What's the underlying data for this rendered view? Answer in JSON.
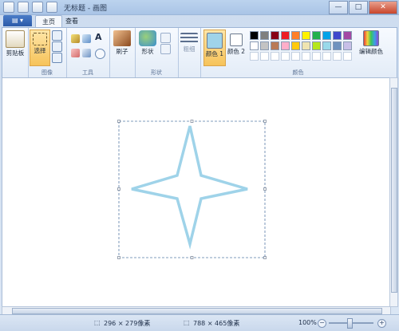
{
  "window": {
    "title": "无标题 - 画图"
  },
  "tabs": {
    "file": "▤ ▾",
    "home": "主页",
    "view": "查看"
  },
  "ribbon": {
    "clipboard": {
      "label": "剪贴板"
    },
    "image": {
      "select_label": "选择",
      "group": "图像"
    },
    "tools": {
      "group": "工具",
      "text_tool": "A"
    },
    "brushes": {
      "label": "刷子"
    },
    "shapes": {
      "label": "形状",
      "group": "形状"
    },
    "size": {
      "label": "粗细"
    },
    "colors": {
      "color1_label": "颜色 1",
      "color2_label": "颜色 2",
      "edit_label": "编辑颜色",
      "group": "颜色",
      "color1": "#9fd3e9",
      "color2": "#ffffff",
      "palette_row1": [
        "#000000",
        "#7f7f7f",
        "#880015",
        "#ed1c24",
        "#ff7f27",
        "#fff200",
        "#22b14c",
        "#00a2e8",
        "#3f48cc",
        "#a349a4"
      ],
      "palette_row2": [
        "#ffffff",
        "#c3c3c3",
        "#b97a57",
        "#ffaec9",
        "#ffc90e",
        "#efe4b0",
        "#b5e61d",
        "#99d9ea",
        "#7092be",
        "#c8bfe7"
      ]
    }
  },
  "canvas": {
    "shape_color": "#9fd3e9",
    "shape": "four-point-star"
  },
  "status": {
    "selection_size": "296 × 279像素",
    "canvas_size": "788 × 465像素",
    "zoom": "100%",
    "zoom_out": "−",
    "zoom_in": "+"
  },
  "window_buttons": {
    "minimize": "—",
    "maximize": "□",
    "close": "✕"
  }
}
